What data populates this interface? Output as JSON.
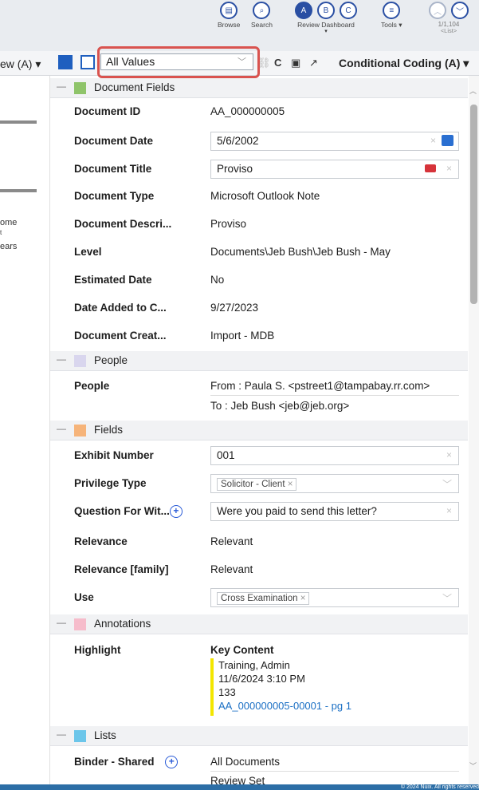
{
  "toolbar": {
    "browse": "Browse",
    "search": "Search",
    "review_dashboard": "Review Dashboard",
    "tools": "Tools",
    "doc_position": "1/1,104",
    "doc_list": "<List>"
  },
  "subbar": {
    "left_title": "ew (A)",
    "field_filter": "All Values",
    "coding_panel": "Conditional Coding (A)"
  },
  "left_pane": {
    "texts": [
      "ome",
      "t",
      "ears"
    ]
  },
  "sections": {
    "document_fields": "Document Fields",
    "people": "People",
    "fields": "Fields",
    "annotations": "Annotations",
    "lists": "Lists"
  },
  "colors": {
    "document_fields": "#8fc46a",
    "people": "#d9d6ee",
    "fields": "#f6b47a",
    "annotations": "#f6bccb",
    "lists": "#6cc6ea",
    "accent": "#2a4fa3",
    "highlight_box": "#d9534f",
    "highlight_bar": "#f3e600"
  },
  "document_fields": {
    "doc_id_label": "Document ID",
    "doc_id_value": "AA_000000005",
    "doc_date_label": "Document Date",
    "doc_date_value": "5/6/2002",
    "doc_title_label": "Document Title",
    "doc_title_value": "Proviso",
    "doc_type_label": "Document Type",
    "doc_type_value": "Microsoft Outlook Note",
    "doc_desc_label": "Document Descri...",
    "doc_desc_value": "Proviso",
    "level_label": "Level",
    "level_value": "Documents\\Jeb Bush\\Jeb Bush - May",
    "est_date_label": "Estimated Date",
    "est_date_value": "No",
    "date_added_label": "Date Added to C...",
    "date_added_value": "9/27/2023",
    "doc_creat_label": "Document Creat...",
    "doc_creat_value": "Import - MDB"
  },
  "people": {
    "label": "People",
    "from": "From : Paula S. <pstreet1@tampabay.rr.com>",
    "to": "To : Jeb Bush <jeb@jeb.org>"
  },
  "fields": {
    "exhibit_label": "Exhibit Number",
    "exhibit_value": "001",
    "privilege_label": "Privilege Type",
    "privilege_value": "Solicitor - Client",
    "question_label": "Question For Wit...",
    "question_value": "Were you paid to send this letter?",
    "relevance_label": "Relevance",
    "relevance_value": "Relevant",
    "relevance_family_label": "Relevance [family]",
    "relevance_family_value": "Relevant",
    "use_label": "Use",
    "use_value": "Cross Examination"
  },
  "annotations": {
    "highlight_label": "Highlight",
    "title": "Key Content",
    "author": "Training, Admin",
    "timestamp": "11/6/2024 3:10 PM",
    "count": "133",
    "link": "AA_000000005-00001 - pg 1"
  },
  "lists": {
    "binder_label": "Binder - Shared",
    "binder_value_1": "All Documents",
    "binder_value_2": "Review Set"
  },
  "footer": {
    "copyright": "© 2024 Nuix. All rights reserved"
  }
}
